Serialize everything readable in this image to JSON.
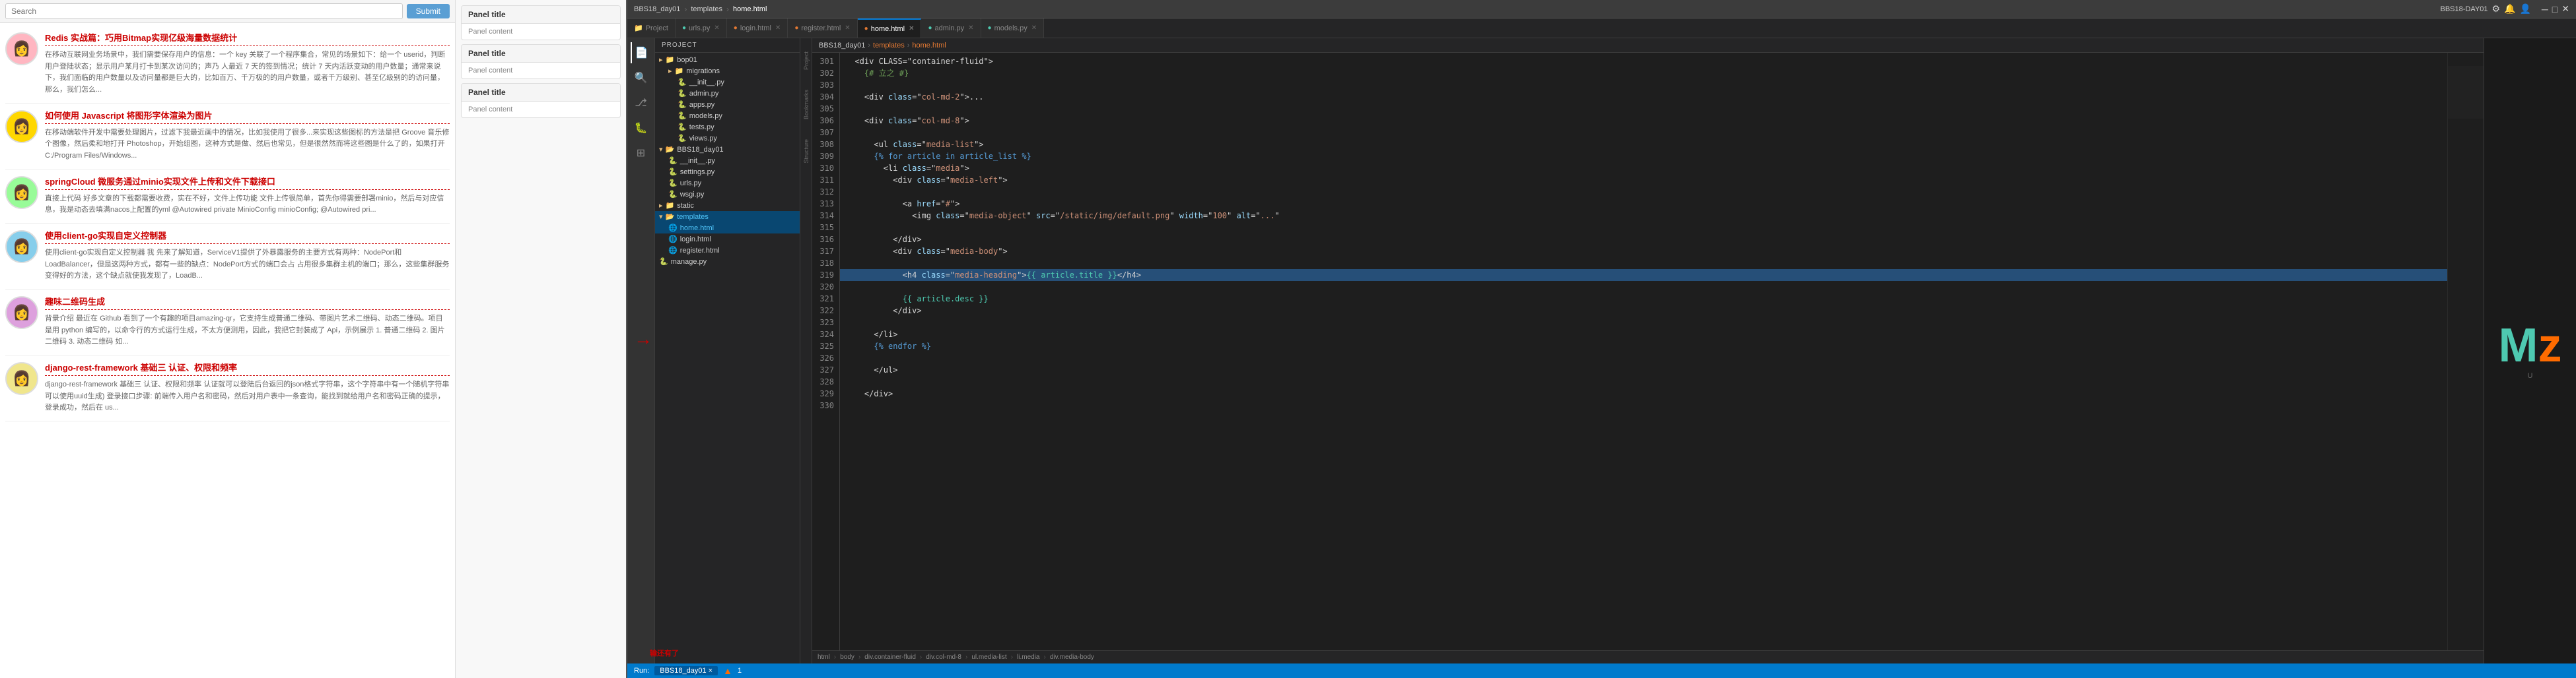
{
  "topbar": {
    "breadcrumb": [
      "BBS18_day01",
      "templates",
      "home.html"
    ],
    "project_name": "BBS18-DAY01",
    "icons": [
      "settings-icon",
      "bell-icon",
      "user-icon",
      "window-icon",
      "minimize-icon",
      "maximize-icon",
      "close-icon"
    ]
  },
  "tabs": [
    {
      "id": "project",
      "label": "Project",
      "icon": "folder",
      "active": false
    },
    {
      "id": "urls_py",
      "label": "urls.py",
      "icon": "py",
      "active": false,
      "closable": true
    },
    {
      "id": "login_html",
      "label": "login.html",
      "icon": "html",
      "active": false,
      "closable": true
    },
    {
      "id": "register_html",
      "label": "register.html",
      "icon": "html",
      "active": false,
      "closable": true
    },
    {
      "id": "home_html",
      "label": "home.html",
      "icon": "html",
      "active": true,
      "closable": true
    },
    {
      "id": "admin_py",
      "label": "admin.py",
      "icon": "py",
      "active": false,
      "closable": true
    },
    {
      "id": "models_py",
      "label": "models.py",
      "icon": "py",
      "active": false,
      "closable": true
    }
  ],
  "breadcrumb_path": [
    "BBS18_day01",
    "templates",
    "home.html"
  ],
  "file_tree": {
    "root": "BBS18_day01",
    "items": [
      {
        "id": "bop01",
        "label": "bop01",
        "type": "folder",
        "indent": 0,
        "expanded": false
      },
      {
        "id": "migrations",
        "label": "migrations",
        "type": "folder",
        "indent": 1,
        "expanded": false
      },
      {
        "id": "init_py",
        "label": "__init__.py",
        "type": "py",
        "indent": 2
      },
      {
        "id": "admin_py",
        "label": "admin.py",
        "type": "py",
        "indent": 2
      },
      {
        "id": "apps_py",
        "label": "apps.py",
        "type": "py",
        "indent": 2
      },
      {
        "id": "models_py",
        "label": "models.py",
        "type": "py",
        "indent": 2
      },
      {
        "id": "tests_py",
        "label": "tests.py",
        "type": "py",
        "indent": 2
      },
      {
        "id": "views_py",
        "label": "views.py",
        "type": "py",
        "indent": 2
      },
      {
        "id": "BBS18_day01_folder",
        "label": "BBS18_day01",
        "type": "folder",
        "indent": 0,
        "expanded": true
      },
      {
        "id": "init_py2",
        "label": "__init__.py",
        "type": "py",
        "indent": 1
      },
      {
        "id": "settings_py",
        "label": "settings.py",
        "type": "py",
        "indent": 1
      },
      {
        "id": "urls_py",
        "label": "urls.py",
        "type": "py",
        "indent": 1
      },
      {
        "id": "wsgi_py",
        "label": "wsgi.py",
        "type": "py",
        "indent": 1
      },
      {
        "id": "static_folder",
        "label": "static",
        "type": "folder",
        "indent": 0,
        "expanded": false
      },
      {
        "id": "templates_folder",
        "label": "templates",
        "type": "folder",
        "indent": 0,
        "expanded": true,
        "active": true
      },
      {
        "id": "home_html",
        "label": "home.html",
        "type": "html",
        "indent": 1,
        "active": true
      },
      {
        "id": "login_html",
        "label": "login.html",
        "type": "html",
        "indent": 1
      },
      {
        "id": "register_html",
        "label": "register.html",
        "type": "html",
        "indent": 1
      },
      {
        "id": "manage_py",
        "label": "manage.py",
        "type": "py",
        "indent": 0
      }
    ]
  },
  "code": {
    "lines": [
      {
        "num": 301,
        "content": "<div CLASS=\"container-fluid\">"
      },
      {
        "num": 302,
        "content": "  {# 立之 #}"
      },
      {
        "num": 303,
        "content": "  "
      },
      {
        "num": 304,
        "content": "  <div class=\"col-md-2\">..."
      },
      {
        "num": 305,
        "content": "  "
      },
      {
        "num": 306,
        "content": "  <div class=\"col-md-8\">"
      },
      {
        "num": 307,
        "content": ""
      },
      {
        "num": 308,
        "content": "    <ul class=\"media-list\">"
      },
      {
        "num": 309,
        "content": "    {% for article in article_list %}"
      },
      {
        "num": 310,
        "content": "      <li class=\"media\">"
      },
      {
        "num": 311,
        "content": "        <div class=\"media-left\">"
      },
      {
        "num": 312,
        "content": ""
      },
      {
        "num": 313,
        "content": "          <a href=\"#\">"
      },
      {
        "num": 314,
        "content": "            <img class=\"media-object\" src=\"/static/img/default.png\" width=\"100\" alt=\"...\""
      },
      {
        "num": 315,
        "content": ""
      },
      {
        "num": 316,
        "content": "        </div>"
      },
      {
        "num": 317,
        "content": "        <div class=\"media-body\">"
      },
      {
        "num": 318,
        "content": ""
      },
      {
        "num": 319,
        "content": "          <h4 class=\"media-heading\">{{ article.title }}</h4>"
      },
      {
        "num": 320,
        "content": ""
      },
      {
        "num": 321,
        "content": "          {{ article.desc }}"
      },
      {
        "num": 322,
        "content": "        </div>"
      },
      {
        "num": 323,
        "content": ""
      },
      {
        "num": 324,
        "content": "    </li>"
      },
      {
        "num": 325,
        "content": "    {% endfor %}"
      },
      {
        "num": 326,
        "content": ""
      },
      {
        "num": 327,
        "content": "    </ul>"
      },
      {
        "num": 328,
        "content": ""
      },
      {
        "num": 329,
        "content": "  </div>"
      },
      {
        "num": 330,
        "content": ""
      }
    ],
    "active_line": 341
  },
  "bottom_bar": {
    "items": [
      "html",
      "body",
      "div.container-fluid",
      "div.col-md-8",
      "ul.media-list",
      "li.media",
      "div.media-body"
    ]
  },
  "status": {
    "run_label": "Run:",
    "run_file": "BBS18_day01",
    "bottom_items": [
      "BBS18_day01 ×"
    ]
  },
  "blog_posts": [
    {
      "id": 1,
      "title": "Redis 实战篇：巧用Bitmap实现亿级海量数据统计",
      "excerpt": "在移动互联网业务场景中，我们需要保存用户的信息：一个 key 关联了一个程序集合，常见的场景如下：给一个 userid，判断用户登陆状态；显示用户某月打卡到某次访问的；声乃 人最近 7 天的签到情况；统计 7 天内活跃变动的用户数量；通常来说下，我们面临的用户数量以及访问量都是巨大的，比如百万、千万极的的用户数量，或者千万级别、甚至亿级别的的访问量，那么，我们怎么..."
    },
    {
      "id": 2,
      "title": "如何使用 Javascript 将图形字体渲染为图片",
      "excerpt": "在移动端软件开发中需要处理图片，过滤下我最近画中的情况，比如我使用了很多...来实现这些图标的方法是把 Groove 音乐修个图像，然后柔和地打开 Photoshop，开始组图，这种方式是做、然后也常见，但是很然然而将这些图是什么了的，如果打开 C:/Program Files/Windows..."
    },
    {
      "id": 3,
      "title": "springCloud 微服务通过minio实现文件上传和文件下载接口",
      "excerpt": "直接上代码 好多文章的下载都需要收费，实在不好，文件上传功能 文件上传很简单，首先你得需要部署minio，然后与对应信息，我是动态去填满nacos上配置的yml @Autowired private MinioConfig minioConfig; @Autowired pri..."
    },
    {
      "id": 4,
      "title": "使用client-go实现自定义控制器",
      "excerpt": "使用client-go实现自定义控制器 我 先来了解知道，ServiceV1提供了外暴露服务的主要方式有两种：NodePort和LoadBalancer，但是这两种方式，都有一些的缺点：NodePort方式的端口会占 占用很多集群主机的端口；那么，这些集群服务变得好的方法，这个缺点就使我发现了，LoadB..."
    },
    {
      "id": 5,
      "title": "趣味二维码生成",
      "excerpt": "背景介绍 最近在 Github 看到了一个有趣的项目amazing-qr，它支持生成普通二维码、带图片艺术二维码、动态二维码。项目是用 python 编写的，以命令行的方式运行生成，不太方便测用，因此，我把它封装成了 Api，示例展示 1. 普通二维码 2. 图片二维码 3. 动态二维码 如..."
    },
    {
      "id": 6,
      "title": "django-rest-framework 基础三 认证、权限和频率",
      "excerpt": "django-rest-framework 基础三 认证、权限和频率 认证就可以登陆后台返回的json格式字符串，这个字符串中有一个随机字符串可以使用uuid生成) 登录接口步骤: 前端传入用户名和密码，然后对用户表中一条查询，能找到就给用户名和密码正确的提示，登录成功，然后在 us..."
    }
  ],
  "cards": [
    {
      "title": "Panel title",
      "content": "Panel content"
    },
    {
      "title": "Panel title",
      "content": "Panel content"
    },
    {
      "title": "Panel title",
      "content": "Panel content"
    }
  ],
  "annotation": {
    "arrow_text": "输还有了",
    "arrow_label": "→"
  },
  "search": {
    "placeholder": "Search",
    "button_label": "Submit"
  }
}
